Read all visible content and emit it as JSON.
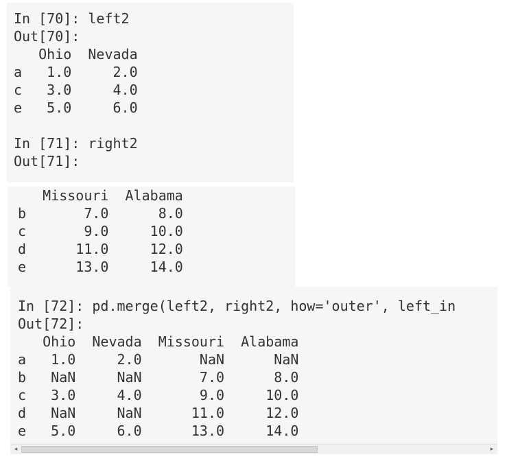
{
  "cells": [
    {
      "lines": [
        "In [70]: left2",
        "Out[70]:",
        "   Ohio  Nevada",
        "a   1.0     2.0",
        "c   3.0     4.0",
        "e   5.0     6.0",
        "",
        "In [71]: right2",
        "Out[71]:"
      ]
    },
    {
      "lines": [
        "   Missouri  Alabama",
        "b       7.0      8.0",
        "c       9.0     10.0",
        "d      11.0     12.0",
        "e      13.0     14.0"
      ]
    },
    {
      "lines": [
        "In [72]: pd.merge(left2, right2, how='outer', left_in",
        "Out[72]:",
        "   Ohio  Nevada  Missouri  Alabama",
        "a   1.0     2.0       NaN      NaN",
        "b   NaN     NaN       7.0      8.0",
        "c   3.0     4.0       9.0     10.0",
        "d   NaN     NaN      11.0     12.0",
        "e   5.0     6.0      13.0     14.0"
      ]
    }
  ],
  "scrollbar": {
    "left_arrow": "◂",
    "right_arrow": "▸"
  },
  "colors": {
    "panel_bg": "#f6f6f6",
    "text": "#333333"
  }
}
